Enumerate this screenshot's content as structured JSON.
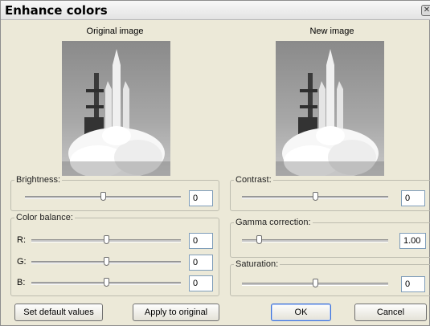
{
  "window": {
    "title": "Enhance colors",
    "close_glyph": "✕"
  },
  "preview": {
    "original_caption": "Original image",
    "new_caption": "New image",
    "image_description_icon": "shuttle-launch-image"
  },
  "brightness": {
    "legend": "Brightness:",
    "value": "0",
    "level": 0.5
  },
  "contrast": {
    "legend": "Contrast:",
    "value": "0",
    "level": 0.5
  },
  "color_balance": {
    "legend": "Color balance:",
    "channels": [
      {
        "label": "R:",
        "value": "0",
        "level": 0.5
      },
      {
        "label": "G:",
        "value": "0",
        "level": 0.5
      },
      {
        "label": "B:",
        "value": "0",
        "level": 0.5
      }
    ]
  },
  "gamma": {
    "legend": "Gamma correction:",
    "value": "1.00",
    "level": 0.1
  },
  "saturation": {
    "legend": "Saturation:",
    "value": "0",
    "level": 0.5
  },
  "buttons": {
    "set_default": "Set default values",
    "apply_original": "Apply to original",
    "ok": "OK",
    "cancel": "Cancel"
  }
}
